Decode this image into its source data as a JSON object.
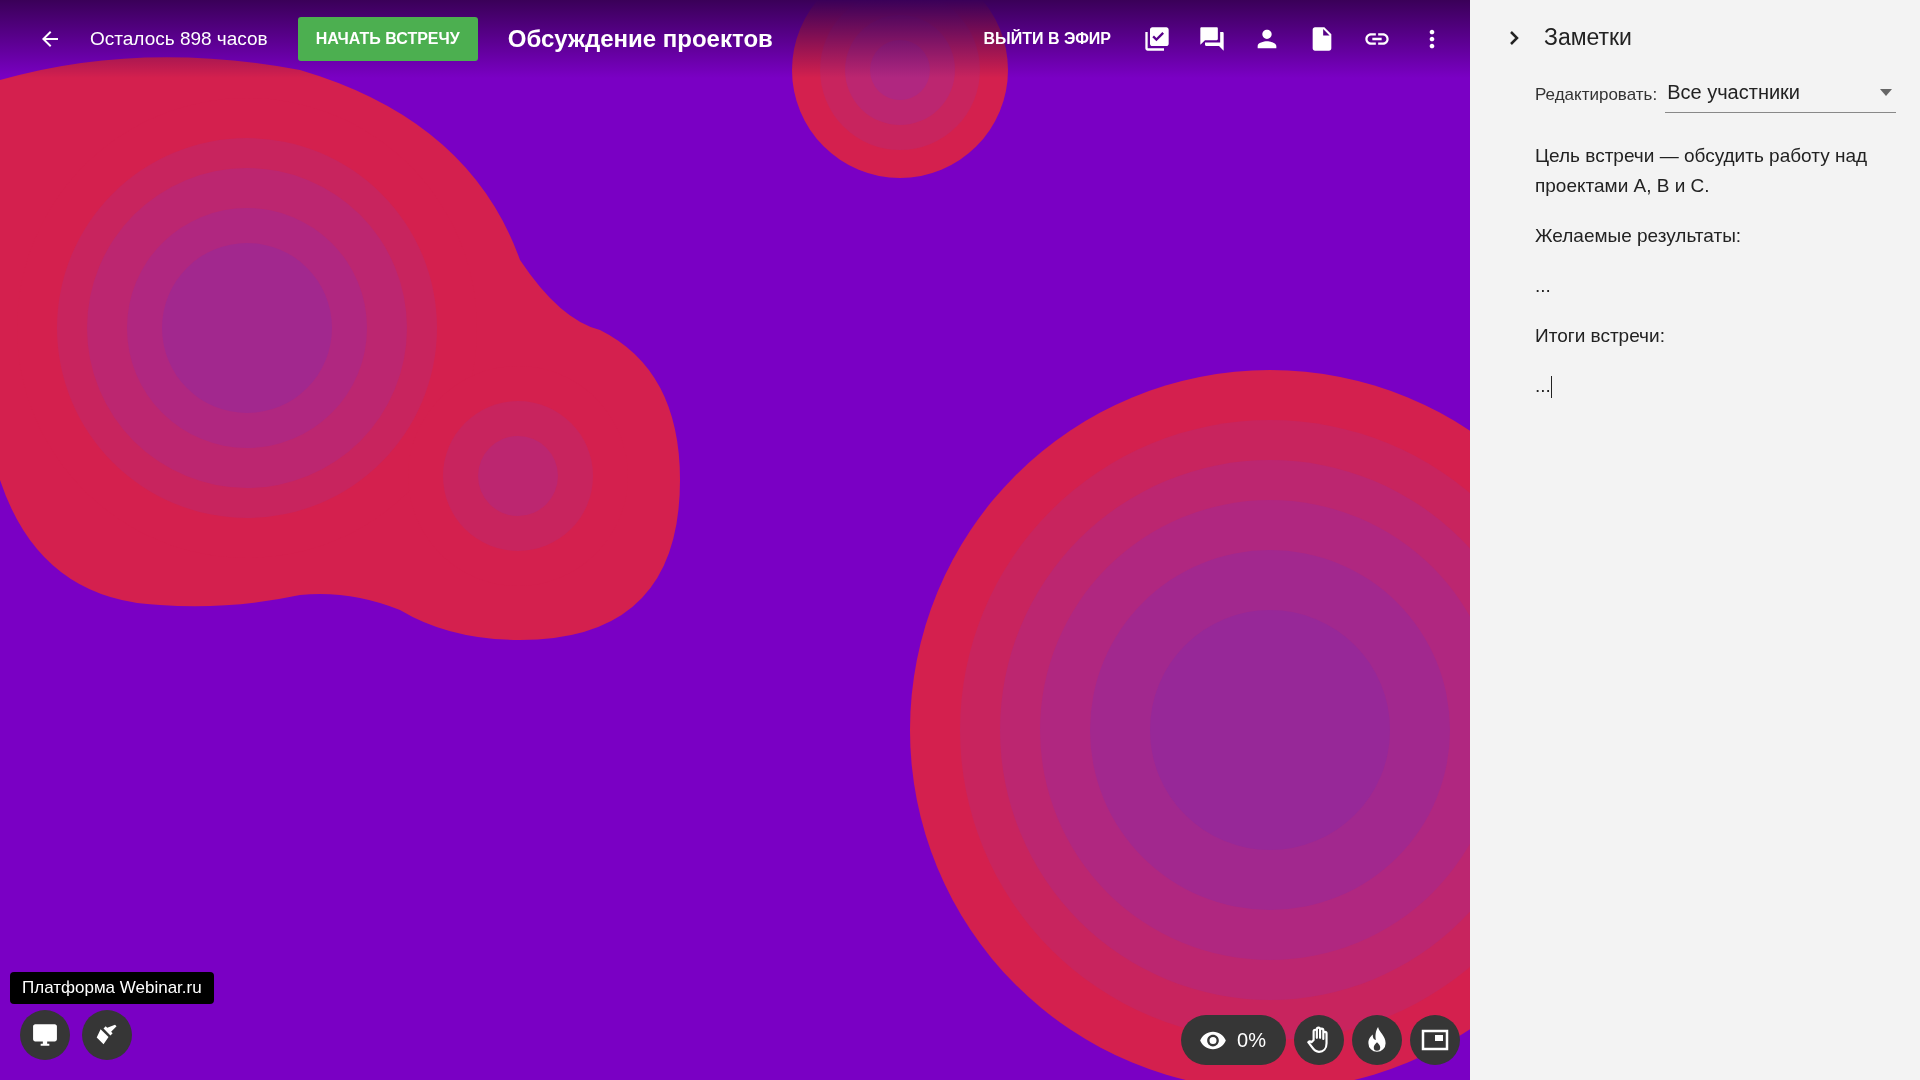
{
  "top_bar": {
    "time_left": "Осталось 898 часов",
    "start_button": "НАЧАТЬ ВСТРЕЧУ",
    "title": "Обсуждение проектов",
    "live_button": "ВЫЙТИ В ЭФИР"
  },
  "platform_label": "Платформа Webinar.ru",
  "viewers": {
    "reading": "0%"
  },
  "notes": {
    "title": "Заметки",
    "edit_label": "Редактировать:",
    "edit_value": "Все участники",
    "paragraphs": [
      "Цель встречи — обсудить работу над проектами А, В и С.",
      "Желаемые результаты:",
      "...",
      "Итоги встречи:",
      "..."
    ]
  }
}
